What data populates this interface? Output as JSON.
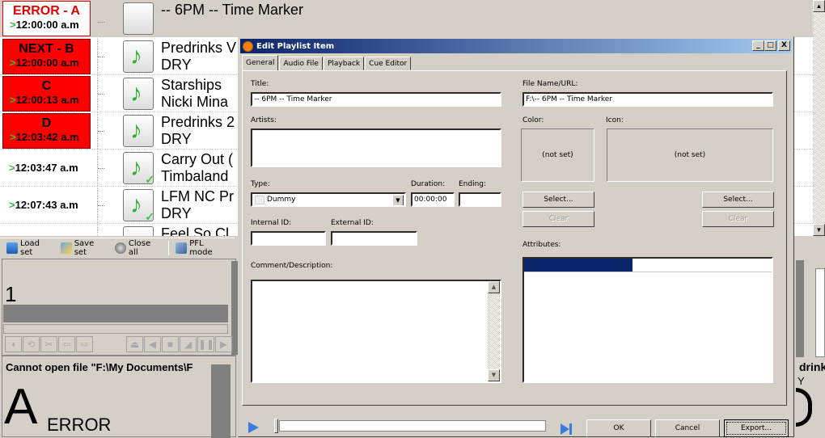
{
  "playlist": {
    "rows": [
      {
        "slot_label": "ERROR - A",
        "time": "12:00:00 a.m",
        "title": "-- 6PM -- Time Marker",
        "artist": "",
        "style": "error"
      },
      {
        "slot_label": "NEXT - B",
        "time": "12:00:00 a.m",
        "title": "Predrinks V",
        "artist": "DRY",
        "style": "red"
      },
      {
        "slot_label": "C",
        "time": "12:00:13 a.m",
        "title": "Starships",
        "artist": "Nicki Mina",
        "style": "red"
      },
      {
        "slot_label": "D",
        "time": "12:03:42 a.m",
        "title": "Predrinks 2",
        "artist": "DRY",
        "style": "red"
      },
      {
        "slot_label": "",
        "time": "12:03:47 a.m",
        "title": "Carry Out (",
        "artist": "Timbaland",
        "style": "plain"
      },
      {
        "slot_label": "",
        "time": "12:07:43 a.m",
        "title": "LFM NC Pr",
        "artist": "DRY",
        "style": "plain"
      },
      {
        "slot_label": "",
        "time": "",
        "title": "Feel So Cl",
        "artist": "",
        "style": "plain"
      }
    ]
  },
  "toolbar": {
    "load_set": "Load set",
    "save_set": "Save set",
    "close_all": "Close all",
    "pfl_mode": "PFL mode"
  },
  "player": {
    "number": "1"
  },
  "error_panel": {
    "message": "Cannot open file \"F:\\My Documents\\F",
    "letter": "A",
    "status": "ERROR"
  },
  "right_strip": {
    "text1": "drink",
    "text2": "Y"
  },
  "dialog": {
    "title": "Edit Playlist Item",
    "tabs": [
      "General",
      "Audio File",
      "Playback",
      "Cue Editor"
    ],
    "active_tab": "General",
    "labels": {
      "title": "Title:",
      "artists": "Artists:",
      "type": "Type:",
      "duration": "Duration:",
      "ending": "Ending:",
      "internal_id": "Internal ID:",
      "external_id": "External ID:",
      "comment": "Comment/Description:",
      "file_name": "File Name/URL:",
      "color": "Color:",
      "icon": "Icon:",
      "attributes": "Attributes:"
    },
    "values": {
      "title": "-- 6PM -- Time Marker",
      "artists": "",
      "type": "Dummy",
      "duration": "00:00:00",
      "ending": "",
      "internal_id": "",
      "external_id": "",
      "comment": "",
      "file_name": "F:\\-- 6PM -- Time Marker",
      "color": "(not set)",
      "icon": "(not set)"
    },
    "buttons": {
      "color_select": "Select...",
      "color_clear": "Clear",
      "icon_select": "Select...",
      "icon_clear": "Clear",
      "ok": "OK",
      "cancel": "Cancel",
      "export": "Export..."
    },
    "window_buttons": {
      "minimize": "_",
      "maximize": "□",
      "close": "X"
    }
  }
}
